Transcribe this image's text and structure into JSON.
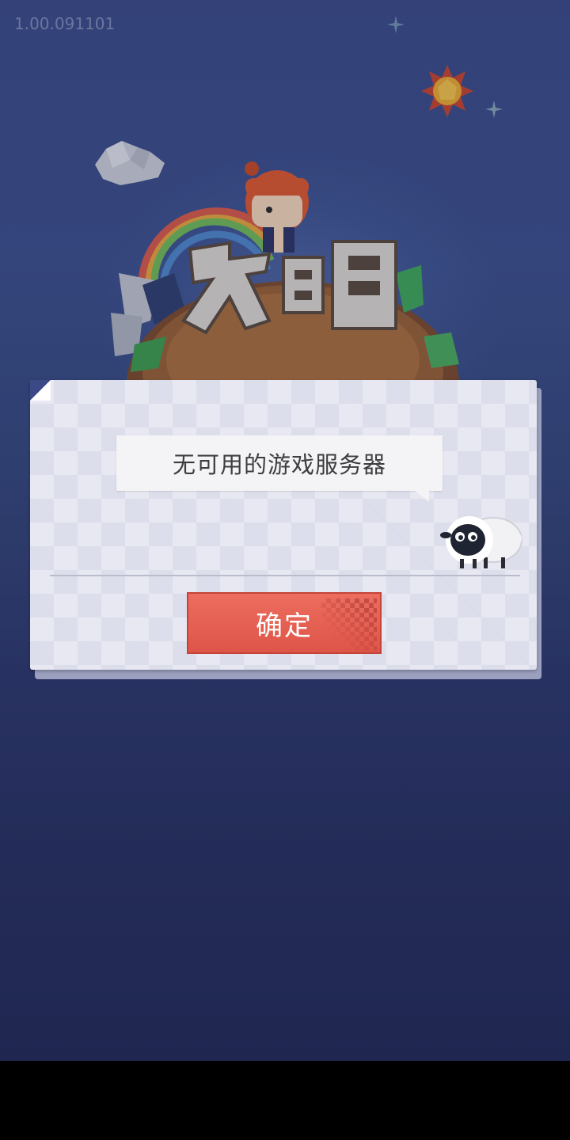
{
  "app": {
    "version": "1.00.091101"
  },
  "background": {
    "logo_icon": "civilization-logo-art",
    "colors": {
      "sky_top": "#3a4a86",
      "sky_bottom": "#222a56"
    }
  },
  "dialog": {
    "message": "无可用的游戏服务器",
    "confirm_label": "确定",
    "mascot_icon": "sheep-icon",
    "colors": {
      "paper": "#e8e8f2",
      "button": "#e4604f",
      "text": "#3e3c40"
    }
  }
}
